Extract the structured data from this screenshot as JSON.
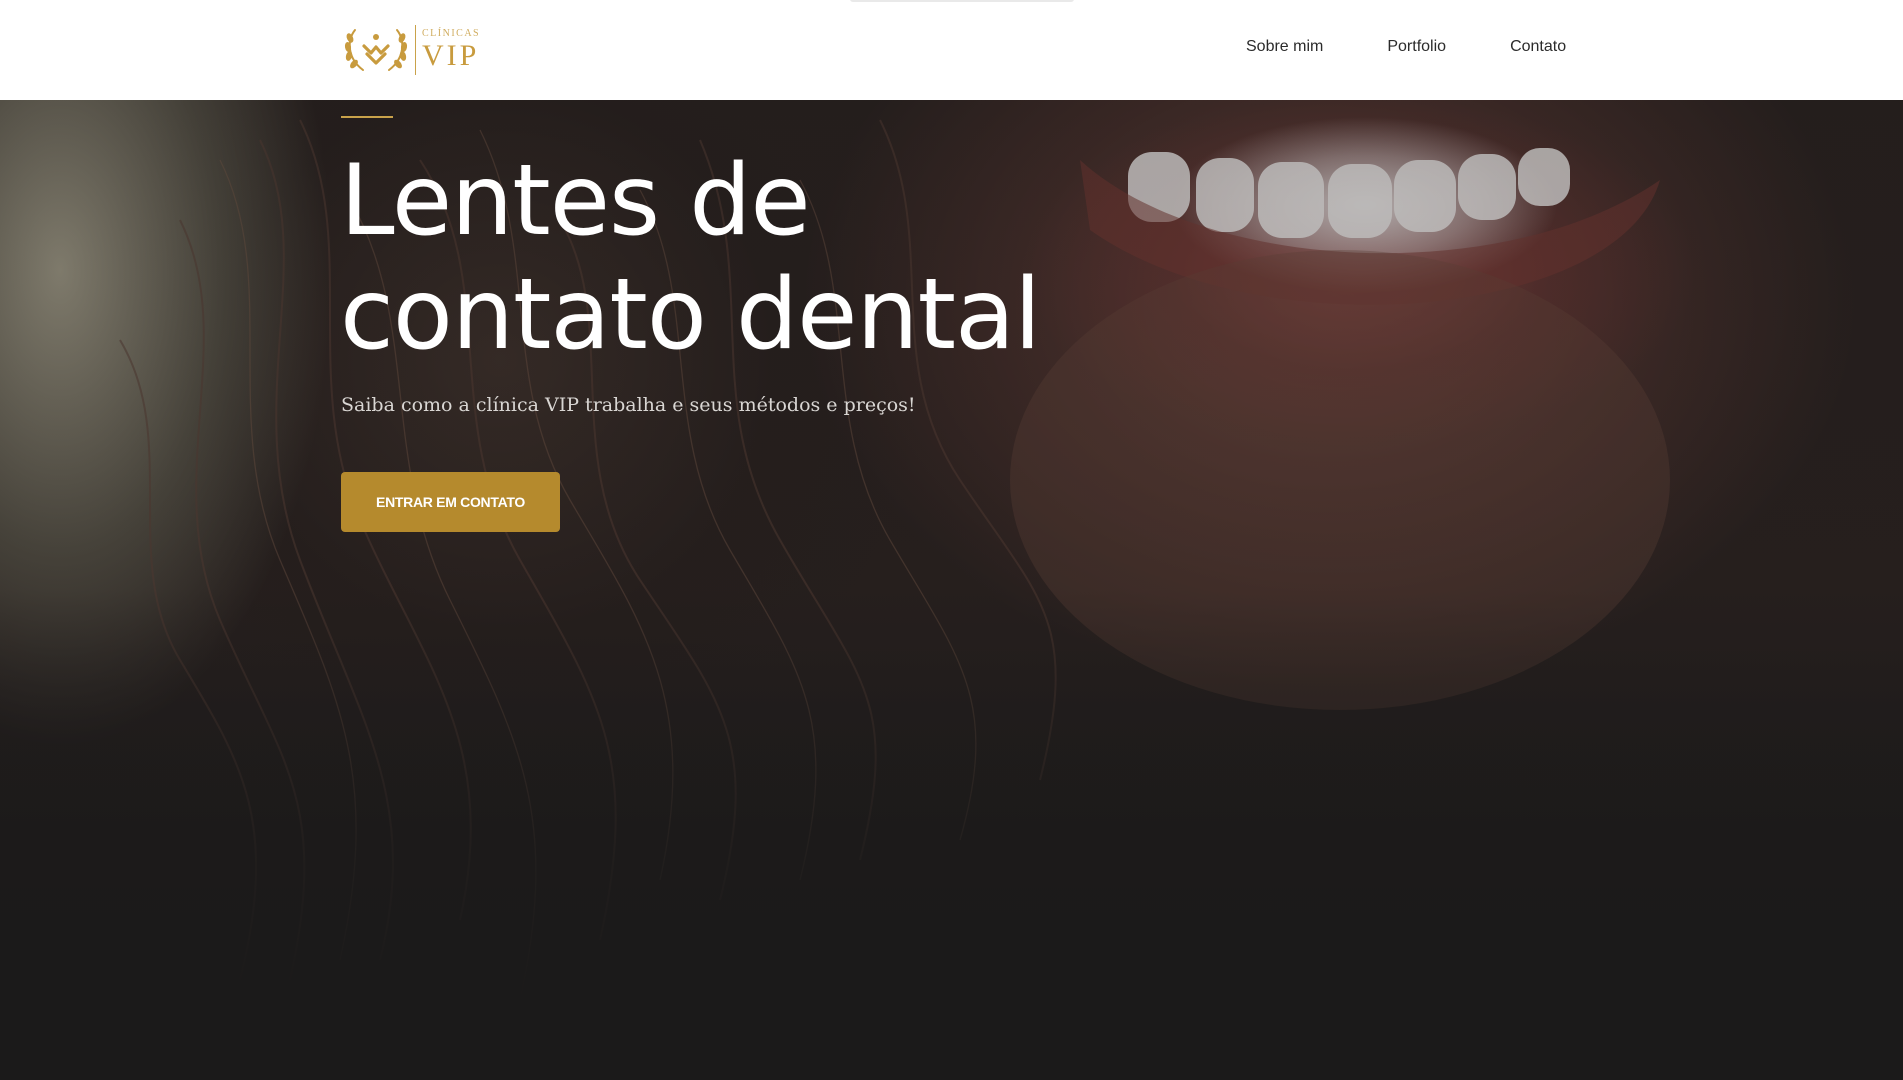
{
  "header": {
    "logo": {
      "small_text": "CLÍNICAS",
      "big_text": "VIP",
      "icon": "laurel-emblem-icon",
      "color": "#c89b3e"
    },
    "nav": [
      {
        "label": "Sobre mim"
      },
      {
        "label": "Portfolio"
      },
      {
        "label": "Contato"
      }
    ]
  },
  "hero": {
    "title": "Lentes de contato dental",
    "subtitle": "Saiba como a clínica VIP trabalha e seus métodos e preços!",
    "cta_label": "ENTRAR EM CONTATO",
    "accent_color": "#b58a2d",
    "background_image": "smiling-woman-photo"
  }
}
